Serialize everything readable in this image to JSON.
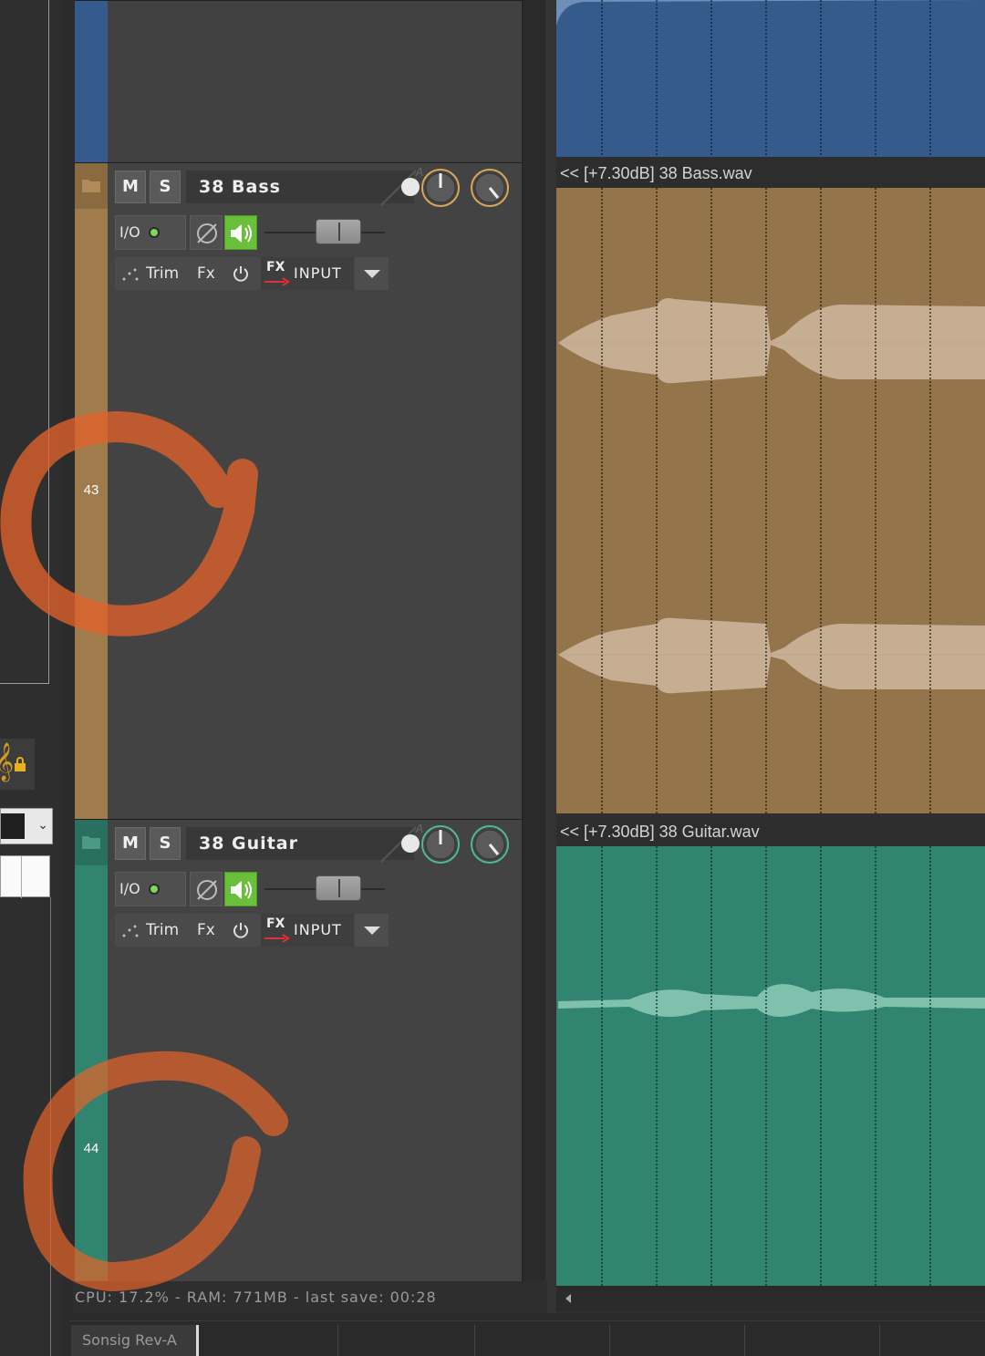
{
  "tracks": [
    {
      "number": "43",
      "name": "38 Bass",
      "mute_label": "M",
      "solo_label": "S",
      "io_label": "I/O",
      "trim_label": "Trim",
      "fx_label": "Fx",
      "fx_input_fx": "FX",
      "fx_input_label": "INPUT",
      "color": "#94744a",
      "strip_color": "#a07c4c",
      "knob_color": "#d8a85a",
      "item_label": "<< [+7.30dB] 38 Bass.wav"
    },
    {
      "number": "44",
      "name": "38 Guitar",
      "mute_label": "M",
      "solo_label": "S",
      "io_label": "I/O",
      "trim_label": "Trim",
      "fx_label": "Fx",
      "fx_input_fx": "FX",
      "fx_input_label": "INPUT",
      "color": "#318470",
      "strip_color": "#318470",
      "knob_color": "#4fb89a",
      "item_label": "<< [+7.30dB] 38 Guitar.wav"
    }
  ],
  "status_bar": {
    "text": "CPU: 17.2% - RAM: 771MB - last save: 00:28"
  },
  "bottom_bar": {
    "project_tab": "Sonsig Rev-A"
  },
  "colors": {
    "top_track": "#355b8c",
    "annotation": "#e0622a",
    "io_led": "#7ed85c",
    "speaker_active": "#6abf3a",
    "clef": "#d49a2a"
  },
  "icons": {
    "folder": "folder-icon",
    "record_arm": "record-arm-icon",
    "envelope": "envelope-icon",
    "speaker": "speaker-icon",
    "power": "power-icon",
    "clef": "treble-clef-icon",
    "lock": "lock-icon"
  }
}
